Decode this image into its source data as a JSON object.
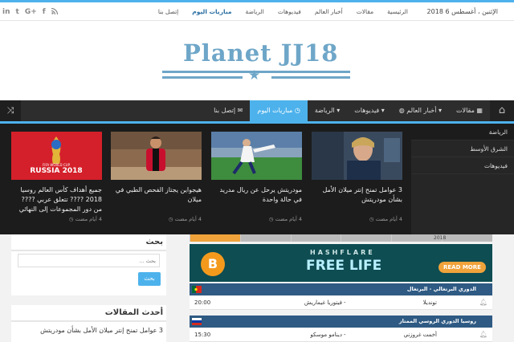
{
  "topbar": {
    "date": "الإثنين ، أغسطس 6 2018",
    "nav": [
      "الرئيسية",
      "مقالات",
      "أخبار العالم",
      "فيديوهات",
      "الرياضة",
      "مباريات اليوم",
      "إتصل بنا"
    ],
    "active_index": 5,
    "social": [
      "in",
      "t",
      "G+",
      "f",
      "rss"
    ]
  },
  "logo": {
    "text": "Planet JJ18"
  },
  "mainnav": {
    "items": [
      {
        "label": "مقالات",
        "icon": "calendar-icon"
      },
      {
        "label": "أخبار العالم",
        "icon": "globe-icon"
      },
      {
        "label": "فيديوهات",
        "icon": "chevron-down-icon"
      },
      {
        "label": "الرياضة",
        "icon": "chevron-down-icon"
      },
      {
        "label": "مباريات اليوم",
        "icon": "clock-icon"
      },
      {
        "label": "إتصل بنا",
        "icon": "envelope-icon"
      }
    ],
    "active_index": 4
  },
  "mega": {
    "side": [
      "الرياضة",
      "الشرق الأوسط",
      "فيديوهات"
    ],
    "cards": [
      {
        "title": "3 عوامل تمنح إنتر ميلان الأمل بشأن مودريتش",
        "meta": "4 أيام مضت"
      },
      {
        "title": "مودريتش يرحل عن ريال مدريد في حالة واحدة",
        "meta": "4 أيام مضت"
      },
      {
        "title": "هيجواين يجتاز الفحص الطبي في ميلان",
        "meta": "4 أيام مضت"
      },
      {
        "title": "جميع أهداف كأس العالم روسيا 2018 ???? تتعلق عربي ???? من دور المجموعات إلى النهائي",
        "meta": "4 أيام مضت"
      }
    ],
    "wc_text": "RUSSIA 2018",
    "wc_sub": "FIFA WORLD CUP"
  },
  "search": {
    "title": "بحث",
    "placeholder": "بحث ...",
    "button": "بحث"
  },
  "recent": {
    "title": "أحدث المقالات",
    "items": [
      "3 عوامل تمنح إنتر ميلان الأمل بشأن مودريتش"
    ]
  },
  "banner": {
    "brand": "HASHFLARE",
    "headline": "FREE LIFE",
    "cta": "READ MORE",
    "coin": "B"
  },
  "leagues": [
    {
      "name": "الدوري البرتغالي - البرتغال",
      "matches": [
        {
          "home": "تونديلا",
          "away": "فيتوريا غيماريش",
          "score": "-",
          "time": "20:00"
        }
      ]
    },
    {
      "name": "روسيا الدوري الروسي الممتاز",
      "matches": [
        {
          "home": "أخمت غروزني",
          "away": "دينامو موسكو",
          "score": "-",
          "time": "15:30"
        }
      ]
    }
  ],
  "top_score_partial": "2018"
}
